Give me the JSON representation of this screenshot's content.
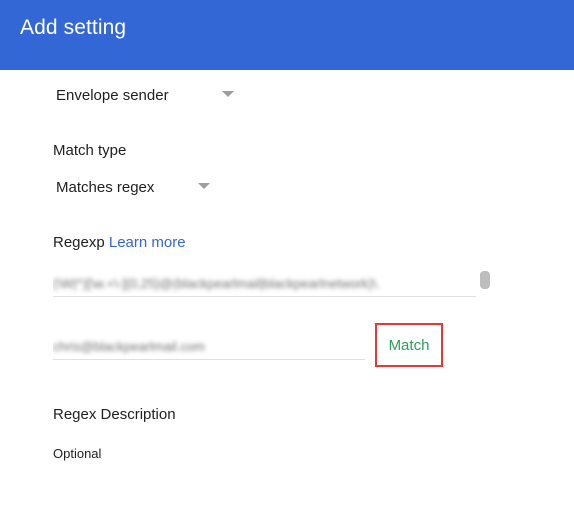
{
  "header": {
    "title": "Add setting"
  },
  "form": {
    "envelope_select": {
      "value": "Envelope sender"
    },
    "match_type": {
      "label": "Match type",
      "value": "Matches regex"
    },
    "regexp": {
      "label": "Regexp",
      "learn_more": "Learn more",
      "value": "(\\W|^)[\\w.+\\-]{0,25}@(blackpearlmail|blackpearlnetwork)\\."
    },
    "test_input": {
      "value": "chris@blackpearlmail.com"
    },
    "match_button": {
      "label": "Match",
      "color": "#2e9e5b",
      "border_color": "#e53935"
    },
    "description": {
      "label": "Regex Description",
      "placeholder": "Optional"
    }
  },
  "colors": {
    "header_bg": "#3367d6",
    "link": "#3367d6"
  },
  "icons": {
    "dropdown": "caret-down-icon"
  }
}
